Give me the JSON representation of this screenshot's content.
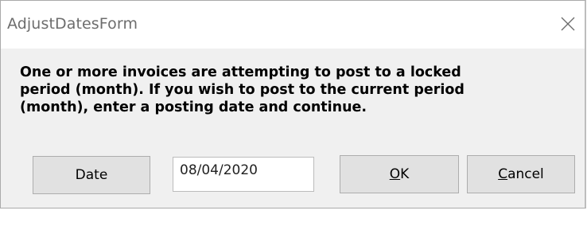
{
  "window": {
    "title": "AdjustDatesForm"
  },
  "icons": {
    "close": "close-icon"
  },
  "message": {
    "text": "One or more invoices are attempting to post to a locked\nperiod (month).  If you wish to post to the current period\n(month), enter a posting date and continue."
  },
  "buttons": {
    "date": "Date",
    "ok_mnemonic": "O",
    "ok_rest": "K",
    "cancel_mnemonic": "C",
    "cancel_rest": "ancel"
  },
  "date_input": {
    "value": "08/04/2020"
  },
  "colors": {
    "dialog_bg": "#f0f0f0",
    "titlebar_bg": "#ffffff",
    "button_bg": "#e1e1e1",
    "button_border": "#adadad"
  }
}
